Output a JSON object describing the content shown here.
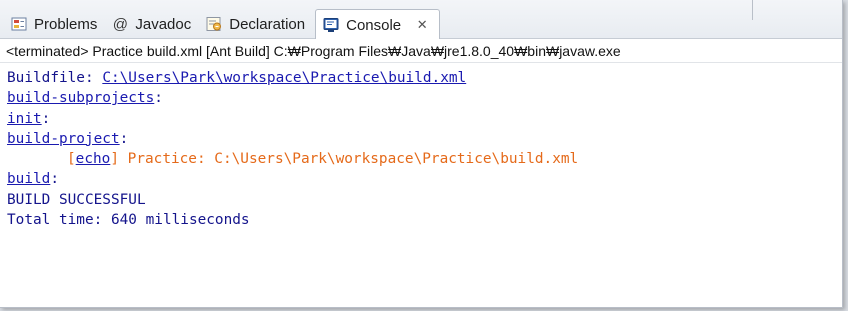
{
  "tabs": [
    {
      "label": "Problems",
      "icon": "problems-icon"
    },
    {
      "label": "Javadoc",
      "icon": "at-sign-icon"
    },
    {
      "label": "Declaration",
      "icon": "declaration-icon"
    },
    {
      "label": "Console",
      "icon": "console-icon",
      "active": true,
      "close": "✕"
    }
  ],
  "status": {
    "text": "<terminated> Practice build.xml [Ant Build] C:₩Program Files₩Java₩jre1.8.0_40₩bin₩javaw.exe"
  },
  "console": {
    "buildfile_label": "Buildfile: ",
    "buildfile_path": "C:\\Users\\Park\\workspace\\Practice\\build.xml",
    "target_build_subprojects": "build-subprojects",
    "target_init": "init",
    "target_build_project": "build-project",
    "echo_open": "[",
    "echo_task": "echo",
    "echo_close": "]",
    "echo_message": " Practice: C:\\Users\\Park\\workspace\\Practice\\build.xml",
    "target_build": "build",
    "colon": ":",
    "result": "BUILD SUCCESSFUL",
    "total_time": "Total time: 640 milliseconds"
  },
  "colors": {
    "target_link": "#1a1ab0",
    "echo_text": "#e56a1a",
    "console_text": "#14148c"
  }
}
